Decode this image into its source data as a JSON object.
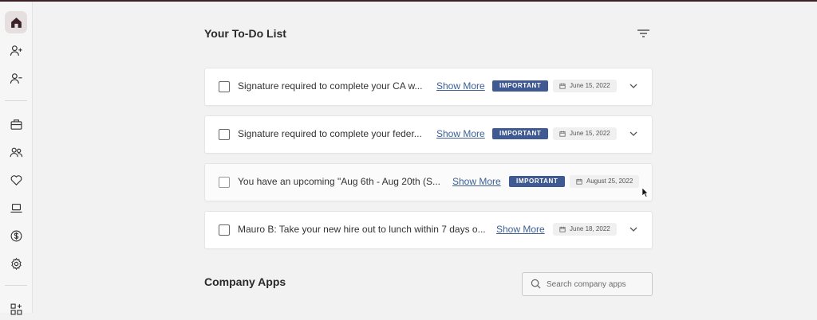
{
  "sidebar": {
    "items": [
      {
        "icon": "home-icon",
        "active": true
      },
      {
        "icon": "add-user-icon"
      },
      {
        "icon": "remove-user-icon"
      },
      {
        "icon": "briefcase-icon"
      },
      {
        "icon": "people-icon"
      },
      {
        "icon": "heart-icon"
      },
      {
        "icon": "laptop-icon"
      },
      {
        "icon": "dollar-icon"
      },
      {
        "icon": "gear-icon"
      },
      {
        "icon": "apps-add-icon"
      }
    ]
  },
  "todo": {
    "title": "Your To-Do List",
    "show_more_label": "Show More",
    "items": [
      {
        "text": "Signature required to complete your CA w...",
        "badge": "IMPORTANT",
        "date": "June 15, 2022"
      },
      {
        "text": "Signature required to complete your feder...",
        "badge": "IMPORTANT",
        "date": "June 15, 2022"
      },
      {
        "text": "You have an upcoming \"Aug 6th - Aug 20th (S...",
        "badge": "IMPORTANT",
        "date": "August 25, 2022"
      },
      {
        "text": "Mauro B: Take your new hire out to lunch within 7 days o...",
        "date": "June 18, 2022"
      }
    ]
  },
  "company_apps": {
    "title": "Company Apps",
    "search_placeholder": "Search company apps"
  },
  "colors": {
    "accent": "#3f5a92",
    "link": "#3d5f95",
    "top_bar": "#3a1f24"
  }
}
